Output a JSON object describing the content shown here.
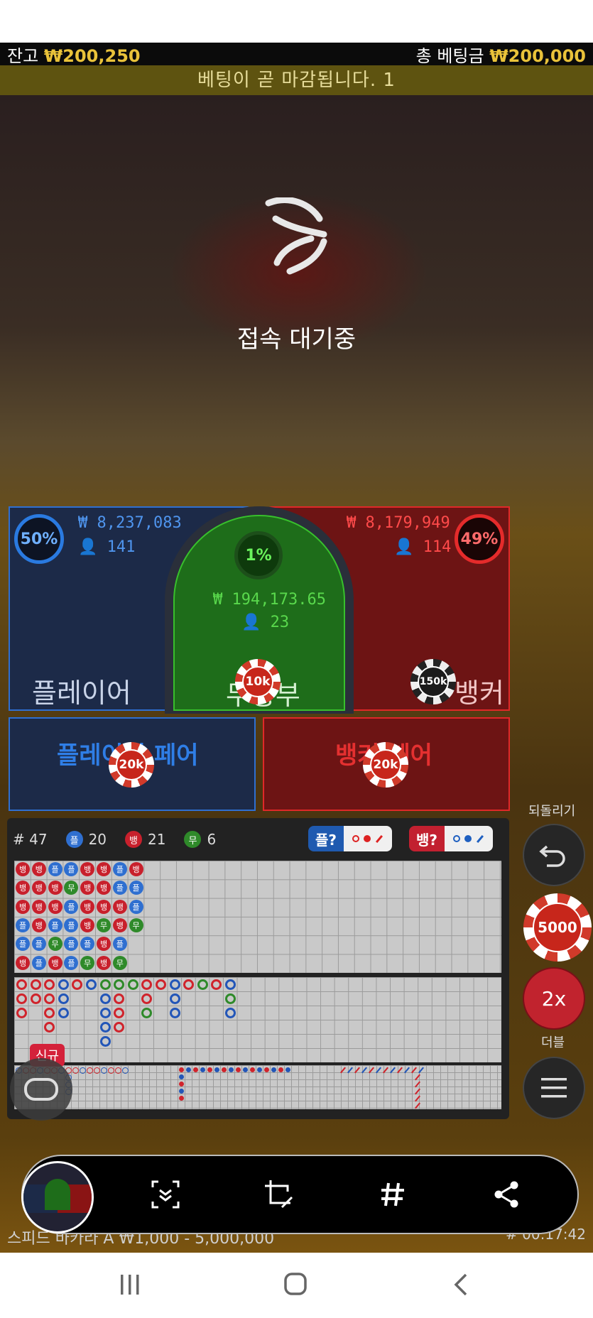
{
  "top": {
    "balance_label": "잔고",
    "balance_value": "₩200,250",
    "total_bet_label": "총 베팅금",
    "total_bet_value": "₩200,000"
  },
  "banner": "베팅이 곧 마감됩니다. 1",
  "status": "접속 대기중",
  "player": {
    "label": "플레이어",
    "percent": "50%",
    "amount": "₩ 8,237,083",
    "count": "141"
  },
  "tie": {
    "label": "무승부",
    "percent": "1%",
    "amount": "₩ 194,173.65",
    "count": "23",
    "chip": "10k"
  },
  "banker": {
    "label": "뱅커",
    "percent": "49%",
    "amount": "₩ 8,179,949",
    "count": "114",
    "chip": "150k"
  },
  "pairs": {
    "player": {
      "label": "플레이어 페어",
      "chip": "20k"
    },
    "banker": {
      "label": "뱅커 페어",
      "chip": "20k"
    }
  },
  "road": {
    "total": "# 47",
    "player_short": "플",
    "player_count": "20",
    "banker_short": "뱅",
    "banker_count": "21",
    "tie_short": "무",
    "tie_count": "6",
    "ask_player": "플?",
    "ask_banker": "뱅?",
    "new_tag": "신규",
    "bead_columns": [
      [
        "뱅",
        "뱅",
        "뱅",
        "플",
        "플",
        "뱅"
      ],
      [
        "뱅",
        "뱅",
        "뱅",
        "뱅",
        "플",
        "플"
      ],
      [
        "플",
        "뱅",
        "뱅",
        "플",
        "무",
        "뱅"
      ],
      [
        "플",
        "무",
        "플",
        "플",
        "플",
        "플"
      ],
      [
        "뱅",
        "뱅",
        "뱅",
        "뱅",
        "플",
        "무"
      ],
      [
        "뱅",
        "뱅",
        "뱅",
        "무",
        "뱅",
        "뱅"
      ],
      [
        "플",
        "플",
        "뱅",
        "뱅",
        "플",
        "무"
      ],
      [
        "뱅",
        "플",
        "플",
        "무",
        "",
        ""
      ]
    ]
  },
  "controls": {
    "undo_label": "되돌리기",
    "chip_value": "5000",
    "double_value": "2x",
    "double_label": "더블"
  },
  "footer": {
    "table_name": "스피드 바카라 A ₩1,000 - 5,000,000",
    "time": "# 00:17:42"
  },
  "colors": {
    "player": "#2f6fd0",
    "banker": "#e02828",
    "tie": "#38c02c",
    "gold": "#e9c23a"
  }
}
